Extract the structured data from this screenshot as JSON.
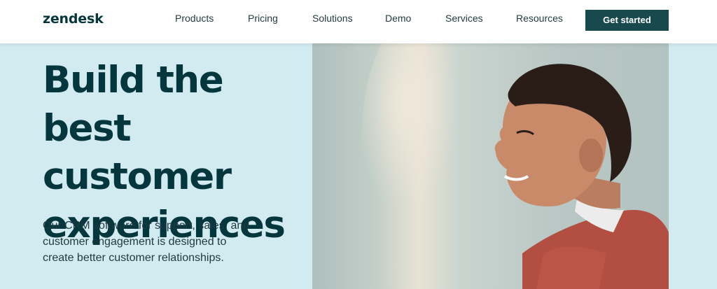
{
  "nav": {
    "logo": "zendesk",
    "items": [
      "Products",
      "Pricing",
      "Solutions",
      "Demo",
      "Services",
      "Resources"
    ],
    "cta": "Get started"
  },
  "hero": {
    "headline": "Build the best customer experiences",
    "subtext": "Our CRM software for support, sales, and customer engagement is designed to create better customer relationships."
  },
  "colors": {
    "brand_dark": "#03363d",
    "cta_bg": "#17494d",
    "hero_bg": "#d1ebf0"
  }
}
